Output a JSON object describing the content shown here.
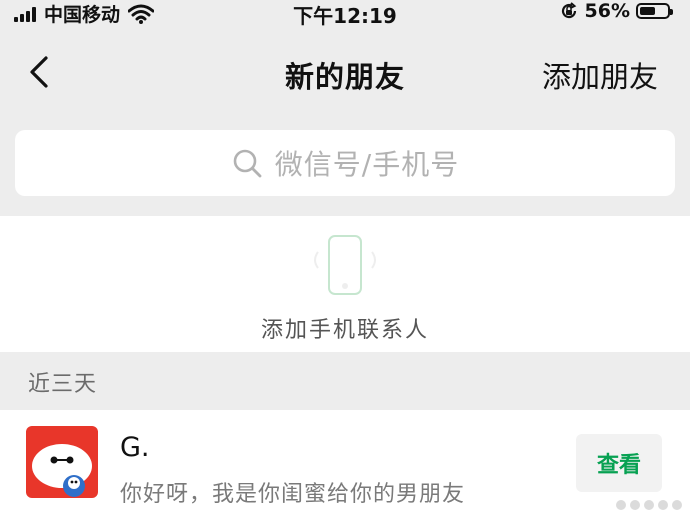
{
  "status_bar": {
    "carrier": "中国移动",
    "time": "下午12:19",
    "battery_percent": "56%",
    "battery_level": 0.56,
    "icons": [
      "signal-icon",
      "wifi-icon",
      "orientation-lock-icon",
      "battery-icon"
    ]
  },
  "nav": {
    "title": "新的朋友",
    "right_action": "添加朋友",
    "back_icon": "chevron-left-icon"
  },
  "search": {
    "placeholder": "微信号/手机号",
    "icon": "search-icon"
  },
  "contacts": {
    "label": "添加手机联系人",
    "icon": "phone-icon"
  },
  "recent": {
    "header": "近三天",
    "items": [
      {
        "name": "G.",
        "message": "你好呀，我是你闺蜜给你的男朋友",
        "action_label": "查看"
      }
    ]
  },
  "colors": {
    "background": "#ededed",
    "surface": "#ffffff",
    "accent_green": "#07a152",
    "avatar_red": "#e8362a"
  }
}
